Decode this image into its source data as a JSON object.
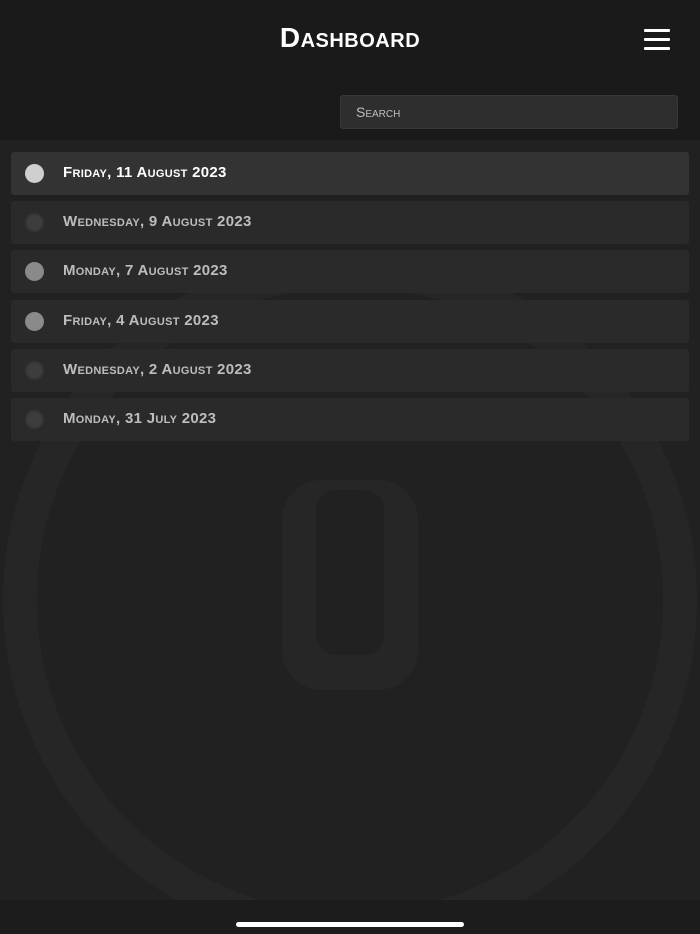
{
  "header": {
    "title": "Dashboard",
    "menu_icon": "hamburger-menu-icon"
  },
  "search": {
    "placeholder": "Search",
    "value": ""
  },
  "list": {
    "items": [
      {
        "label": "Friday, 11 August 2023",
        "status": "bright",
        "selected": true
      },
      {
        "label": "Wednesday, 9 August 2023",
        "status": "dark",
        "selected": false
      },
      {
        "label": "Monday, 7 August 2023",
        "status": "mid",
        "selected": false
      },
      {
        "label": "Friday, 4 August 2023",
        "status": "mid",
        "selected": false
      },
      {
        "label": "Wednesday, 2 August 2023",
        "status": "dark",
        "selected": false
      },
      {
        "label": "Monday, 31 July 2023",
        "status": "dark",
        "selected": false
      }
    ]
  },
  "colors": {
    "background": "#212121",
    "header": "#1a1a1a",
    "row": "#2a2a2a",
    "row_active": "#333333",
    "status_bright": "#cfcfcf",
    "status_mid": "#8a8a8a",
    "status_dark": "#3d3d3d"
  }
}
